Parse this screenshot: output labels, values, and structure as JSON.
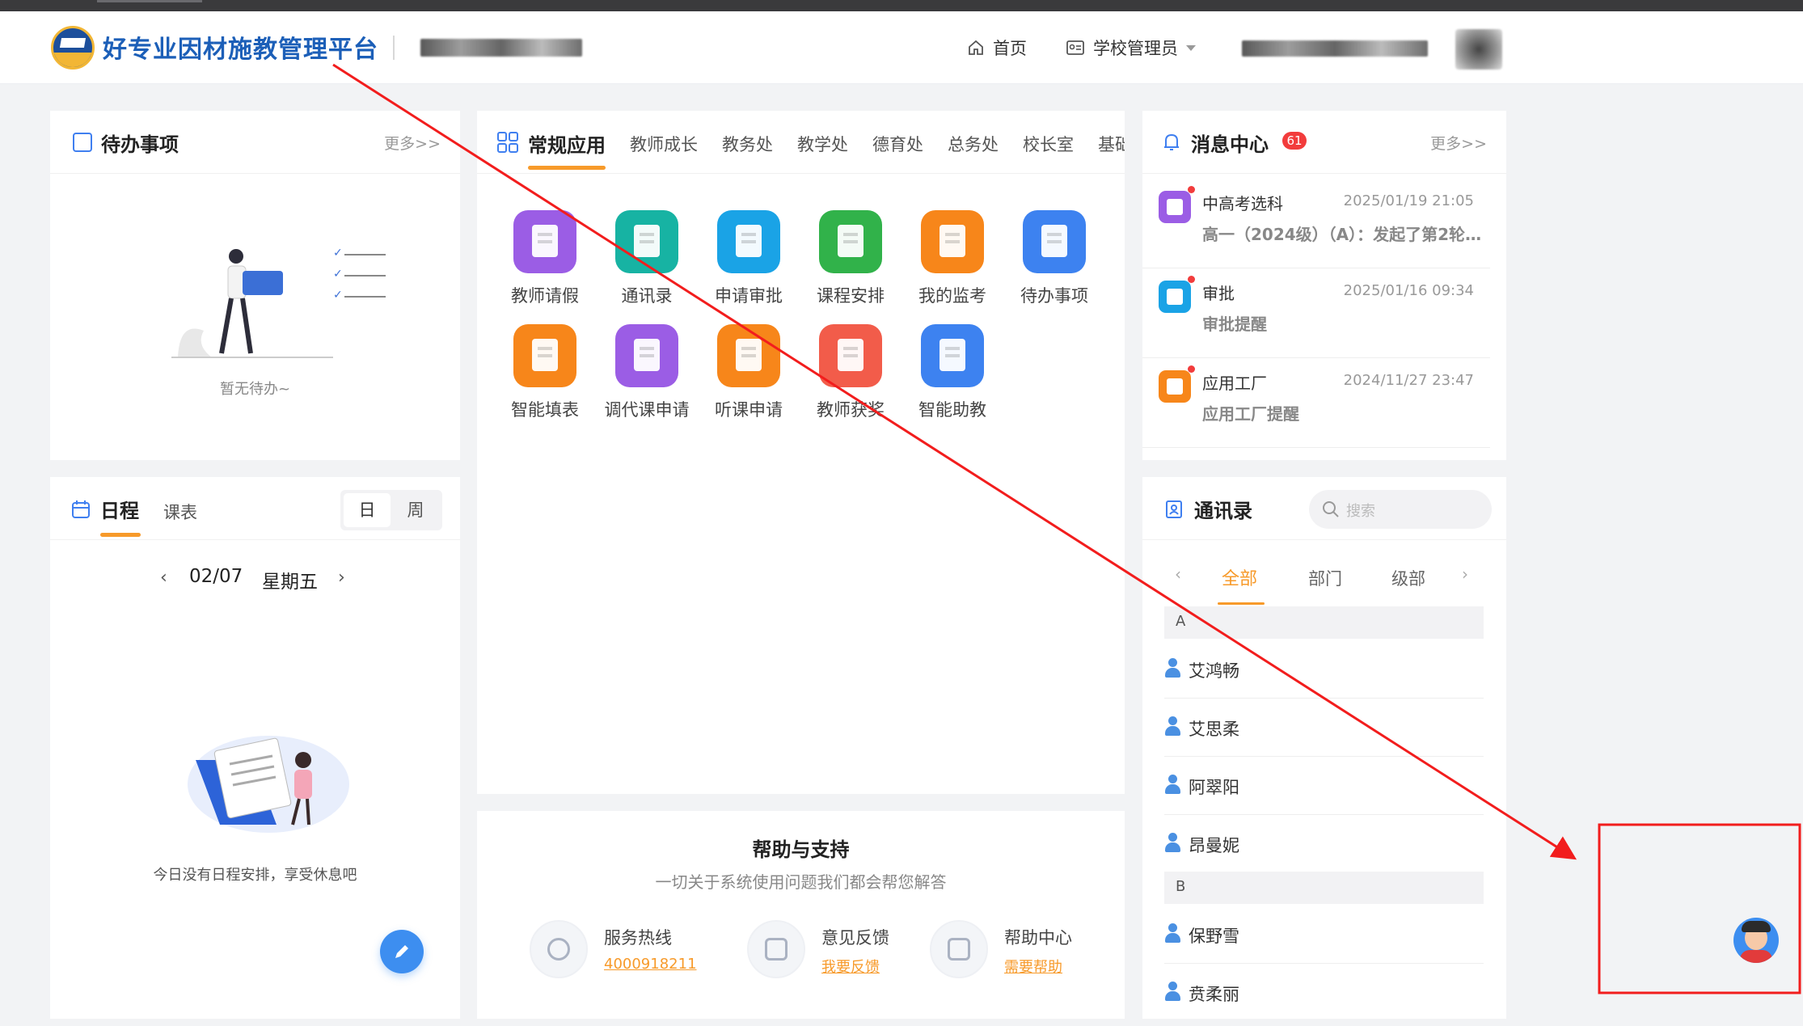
{
  "header": {
    "app_title": "好专业因材施教管理平台",
    "nav_home": "首页",
    "nav_role": "学校管理员"
  },
  "todo": {
    "title": "待办事项",
    "more": "更多>>",
    "empty": "暂无待办~"
  },
  "apps": {
    "tabs": [
      "常规应用",
      "教师成长",
      "教务处",
      "教学处",
      "德育处",
      "总务处",
      "校长室",
      "基础"
    ],
    "items": [
      {
        "label": "教师请假",
        "color": "#9b5de5"
      },
      {
        "label": "通讯录",
        "color": "#17b3a3"
      },
      {
        "label": "申请审批",
        "color": "#1aa3e6"
      },
      {
        "label": "课程安排",
        "color": "#31b24a"
      },
      {
        "label": "我的监考",
        "color": "#f7861a"
      },
      {
        "label": "待办事项",
        "color": "#3d82f0"
      },
      {
        "label": "智能填表",
        "color": "#f7861a"
      },
      {
        "label": "调代课申请",
        "color": "#9b5de5"
      },
      {
        "label": "听课申请",
        "color": "#f7861a"
      },
      {
        "label": "教师获奖",
        "color": "#f25c4a"
      },
      {
        "label": "智能助教",
        "color": "#3d82f0"
      }
    ]
  },
  "messages": {
    "title": "消息中心",
    "badge": "61",
    "more": "更多>>",
    "items": [
      {
        "title": "中高考选科",
        "time": "2025/01/19 21:05",
        "sub": "高一（2024级）（A）：发起了第2轮3...",
        "color": "#9b5de5"
      },
      {
        "title": "审批",
        "time": "2025/01/16 09:34",
        "sub": "审批提醒",
        "color": "#1aa3e6"
      },
      {
        "title": "应用工厂",
        "time": "2024/11/27 23:47",
        "sub": "应用工厂提醒",
        "color": "#f7861a"
      }
    ]
  },
  "schedule": {
    "tab_day": "日程",
    "tab_class": "课表",
    "toggle_day": "日",
    "toggle_week": "周",
    "date": "02/07",
    "weekday": "星期五",
    "empty": "今日没有日程安排，享受休息吧"
  },
  "contacts": {
    "title": "通讯录",
    "search_placeholder": "搜索",
    "tabs": [
      "全部",
      "部门",
      "级部"
    ],
    "groups": [
      {
        "letter": "A",
        "names": [
          "艾鸿畅",
          "艾思柔",
          "阿翠阳",
          "昂曼妮"
        ]
      },
      {
        "letter": "B",
        "names": [
          "保野雪",
          "贲柔丽"
        ]
      }
    ]
  },
  "help": {
    "title": "帮助与支持",
    "subtitle": "一切关于系统使用问题我们都会帮您解答",
    "items": [
      {
        "title": "服务热线",
        "link": "4000918211"
      },
      {
        "title": "意见反馈",
        "link": "我要反馈"
      },
      {
        "title": "帮助中心",
        "link": "需要帮助"
      }
    ]
  },
  "colors": {
    "accent": "#f79a2a",
    "brand": "#1c5fb8",
    "annotation": "#f21d1d"
  }
}
